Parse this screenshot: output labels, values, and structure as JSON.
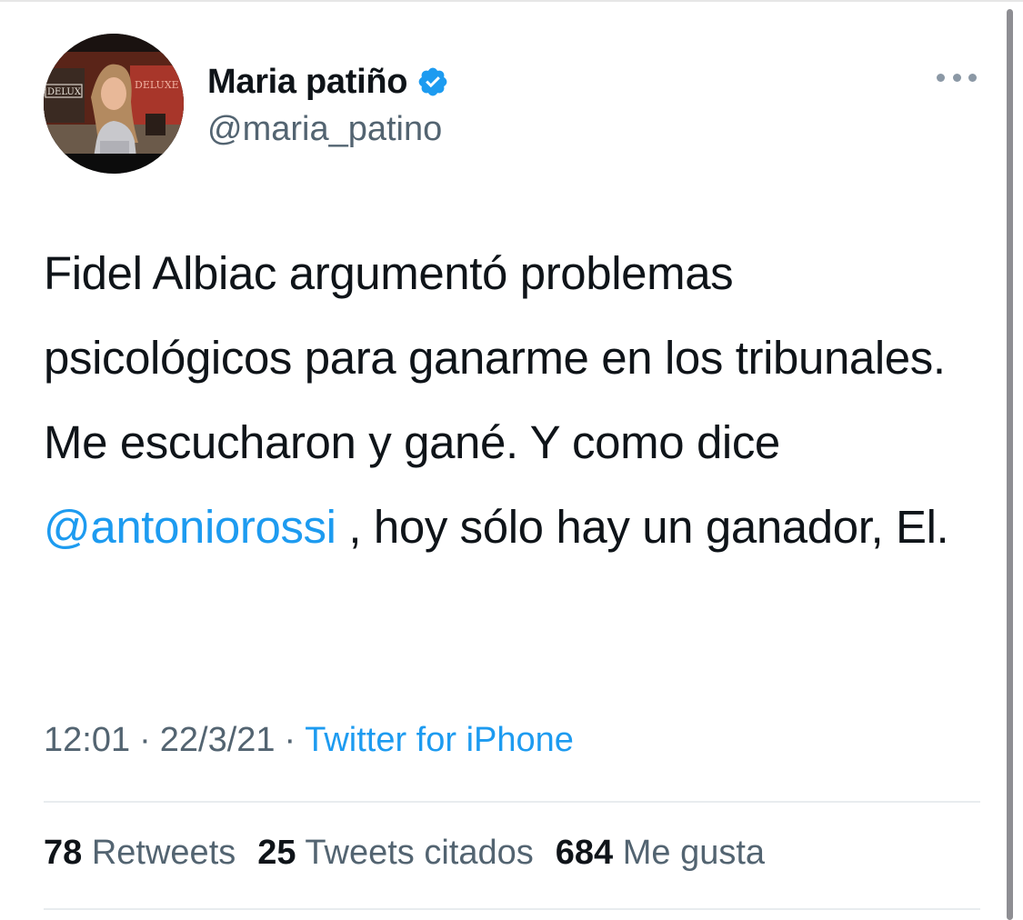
{
  "tweet": {
    "author": {
      "display_name": "Maria patiño",
      "handle": "@maria_patino",
      "verified": true,
      "avatar_sign_left": "DELUX",
      "avatar_sign_right": "DELUXE"
    },
    "text": {
      "part1": "Fidel Albiac argumentó problemas psicológicos para ganarme en los tribunales. Me escucharon y gané. Y como dice ",
      "mention": "@antoniorossi",
      "part2": " , hoy sólo hay un ganador, El."
    },
    "meta": {
      "time": "12:01",
      "separator": "·",
      "date": "22/3/21",
      "source": "Twitter for iPhone"
    },
    "stats": {
      "retweets_count": "78",
      "retweets_label": "Retweets",
      "quotes_count": "25",
      "quotes_label": "Tweets citados",
      "likes_count": "684",
      "likes_label": "Me gusta"
    }
  },
  "colors": {
    "link": "#1d9bf0",
    "secondary_text": "#536471",
    "primary_text": "#0f1419",
    "verified_badge": "#1d9bf0"
  }
}
